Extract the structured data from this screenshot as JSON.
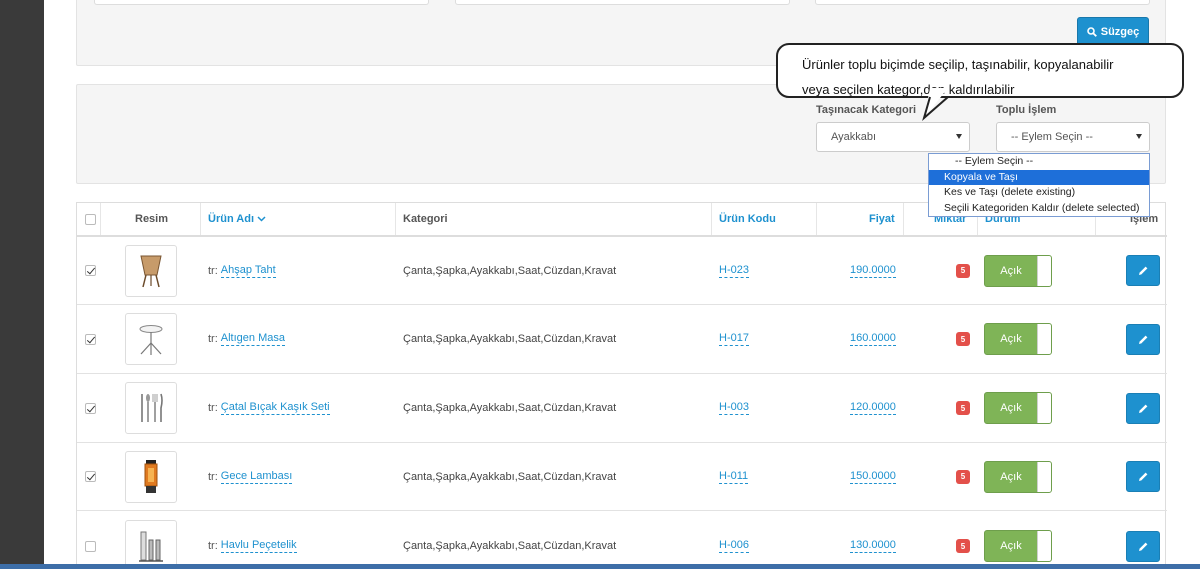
{
  "filter": {
    "button_label": "Süzgeç"
  },
  "batch": {
    "move_category_label": "Taşınacak Kategori",
    "move_category_value": "Ayakkabı",
    "batch_action_label": "Toplu İşlem",
    "batch_action_value": "-- Eylem Seçin --",
    "options": [
      "-- Eylem Seçin --",
      "Kopyala ve Taşı",
      "Kes ve Taşı (delete existing)",
      "Seçili Kategoriden Kaldır (delete selected)"
    ]
  },
  "callout": {
    "line1": "Ürünler toplu biçimde seçilip, taşınabilir, kopyalanabilir",
    "line2": "veya seçilen kategor,den kaldırılabilir"
  },
  "table": {
    "headers": {
      "image": "Resim",
      "name": "Ürün Adı",
      "category": "Kategori",
      "code": "Ürün Kodu",
      "price": "Fiyat",
      "quantity": "Miktar",
      "status": "Durum",
      "action": "İşlem"
    },
    "rows": [
      {
        "prefix": "tr:",
        "name": "Ahşap Taht",
        "category": "Çanta,Şapka,Ayakkabı,Saat,Cüzdan,Kravat",
        "code": "H-023",
        "price": "190.0000",
        "qty": "5",
        "status": "Açık",
        "checked": true,
        "image": "wooden-chair"
      },
      {
        "prefix": "tr:",
        "name": "Altıgen Masa",
        "category": "Çanta,Şapka,Ayakkabı,Saat,Cüzdan,Kravat",
        "code": "H-017",
        "price": "160.0000",
        "qty": "5",
        "status": "Açık",
        "checked": true,
        "image": "hexagon-table"
      },
      {
        "prefix": "tr:",
        "name": "Çatal Bıçak Kaşık Seti",
        "category": "Çanta,Şapka,Ayakkabı,Saat,Cüzdan,Kravat",
        "code": "H-003",
        "price": "120.0000",
        "qty": "5",
        "status": "Açık",
        "checked": true,
        "image": "cutlery-set"
      },
      {
        "prefix": "tr:",
        "name": "Gece Lambası",
        "category": "Çanta,Şapka,Ayakkabı,Saat,Cüzdan,Kravat",
        "code": "H-011",
        "price": "150.0000",
        "qty": "5",
        "status": "Açık",
        "checked": true,
        "image": "night-lamp"
      },
      {
        "prefix": "tr:",
        "name": "Havlu Peçetelik",
        "category": "Çanta,Şapka,Ayakkabı,Saat,Cüzdan,Kravat",
        "code": "H-006",
        "price": "130.0000",
        "qty": "5",
        "status": "Açık",
        "checked": false,
        "image": "napkin-holder"
      }
    ]
  },
  "colors": {
    "primary": "#1e91cf",
    "success": "#7fb457",
    "danger": "#e3504a",
    "highlight": "#1e6fd9"
  }
}
